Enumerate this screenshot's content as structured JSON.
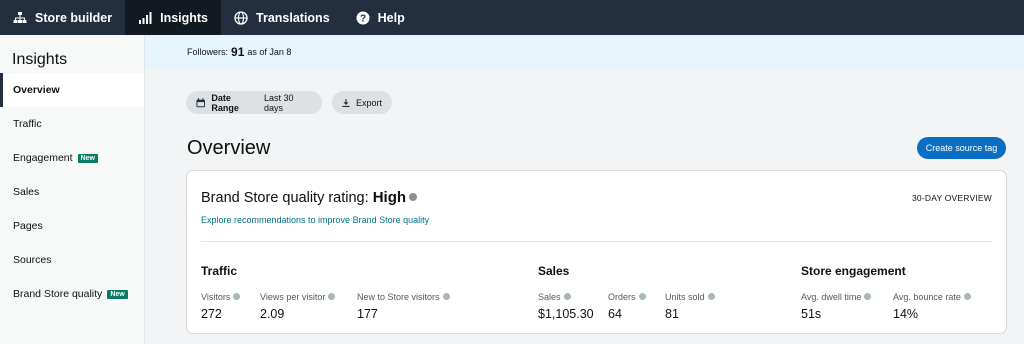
{
  "nav": {
    "tabs": [
      {
        "label": "Store builder",
        "icon": "sitemap-icon"
      },
      {
        "label": "Insights",
        "icon": "bar-chart-icon"
      },
      {
        "label": "Translations",
        "icon": "globe-icon"
      },
      {
        "label": "Help",
        "icon": "question-circle-icon"
      }
    ],
    "active": "Insights"
  },
  "sidebar": {
    "title": "Insights",
    "items": [
      {
        "label": "Overview"
      },
      {
        "label": "Traffic"
      },
      {
        "label": "Engagement",
        "badge": "New"
      },
      {
        "label": "Sales"
      },
      {
        "label": "Pages"
      },
      {
        "label": "Sources"
      },
      {
        "label": "Brand Store quality",
        "badge": "New"
      }
    ]
  },
  "banner": {
    "prefix": "Followers:",
    "count": "91",
    "suffix": "as of Jan 8"
  },
  "filters": {
    "date_range_label": "Date Range",
    "date_range_value": "Last 30 days",
    "export_label": "Export"
  },
  "overview": {
    "heading": "Overview",
    "create_button": "Create source tag"
  },
  "card": {
    "rating_prefix": "Brand Store quality rating:",
    "rating_value": "High",
    "recommendation_link": "Explore recommendations to improve Brand Store quality",
    "period": "30-DAY OVERVIEW",
    "sections": {
      "traffic": {
        "title": "Traffic",
        "metrics": [
          {
            "label": "Visitors",
            "value": "272"
          },
          {
            "label": "Views per visitor",
            "value": "2.09"
          },
          {
            "label": "New to Store visitors",
            "value": "177"
          }
        ]
      },
      "sales": {
        "title": "Sales",
        "metrics": [
          {
            "label": "Sales",
            "value": "$1,105.30"
          },
          {
            "label": "Orders",
            "value": "64"
          },
          {
            "label": "Units sold",
            "value": "81"
          }
        ]
      },
      "engagement": {
        "title": "Store engagement",
        "metrics": [
          {
            "label": "Avg. dwell time",
            "value": "51s"
          },
          {
            "label": "Avg. bounce rate",
            "value": "14%"
          }
        ]
      }
    }
  },
  "colors": {
    "nav_bg": "#232f3e",
    "banner_bg": "#e6f5fb",
    "primary_button": "#0a6fc2",
    "link": "#007185",
    "new_badge": "#067d62"
  }
}
